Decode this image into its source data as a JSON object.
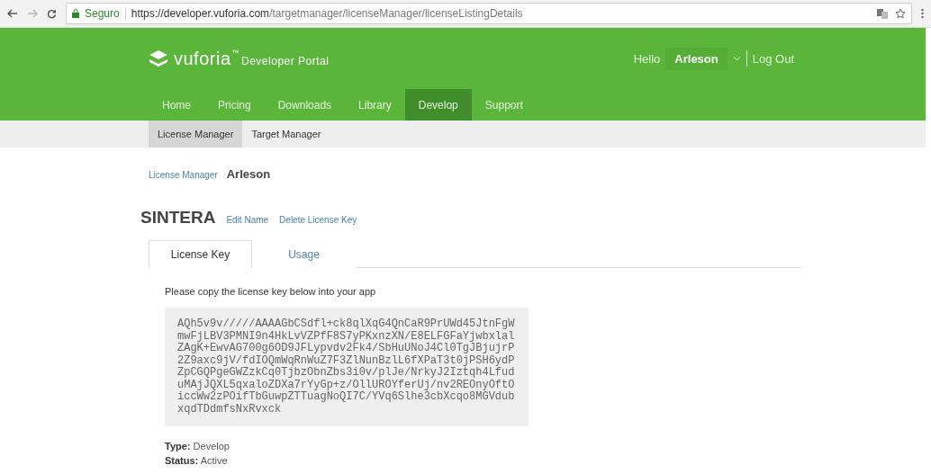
{
  "browser": {
    "security": "Seguro",
    "url_host": "https://developer.vuforia.com",
    "url_path": "/targetmanager/licenseManager/licenseListingDetails"
  },
  "header": {
    "brand": "vuforia",
    "trademark": "™",
    "brand_suffix": "Developer Portal",
    "greeting": "Hello",
    "user": "Arleson",
    "logout": "Log Out"
  },
  "nav": [
    {
      "label": "Home",
      "selected": false
    },
    {
      "label": "Pricing",
      "selected": false
    },
    {
      "label": "Downloads",
      "selected": false
    },
    {
      "label": "Library",
      "selected": false
    },
    {
      "label": "Develop",
      "selected": true
    },
    {
      "label": "Support",
      "selected": false
    }
  ],
  "subnav": [
    {
      "label": "License Manager",
      "selected": true
    },
    {
      "label": "Target Manager",
      "selected": false
    }
  ],
  "breadcrumb": {
    "link": "License Manager",
    "current": "Arleson"
  },
  "license": {
    "name": "SINTERA",
    "actions": [
      "Edit Name",
      "Delete License Key"
    ]
  },
  "tabs": [
    {
      "label": "License Key",
      "selected": true
    },
    {
      "label": "Usage",
      "selected": false
    }
  ],
  "instructions": "Please copy the license key below into your app",
  "key_lines": [
    "AQh5v9v/////AAAAGbCSdfl+ck8qlXqG4QnCaR9PrUWd45JtnFgW",
    "mwFjLBV3PMNI9n4HkLvVZPfF8S7yPKxnzXN/E8ELFGFaYjwbxlal",
    "ZAgK+EwvAG700g6OD9JFLypvdv2Fk4/SbHuUNoJ4Cl0TgJBjujrP",
    "2Z9axc9jV/fdIOQmWqRnWuZ7F3ZlNunBzlL6fXPaT3t0jPSH6ydP",
    "ZpCGQPgeGWZzkCq0TjbzObnZbs3i0v/plJe/NrkyJ2Iztqh4Lfud",
    "uMAjJQXL5qxaloZDXa7rYyGp+z/OllUROYferUj/nv2REOnyOftO",
    "iccWw2zPOifTbGuwpZTTuagNoQI7C/YVq6Slhe3cbXcqo8MGVdub",
    "xqdTDdmfsNxRvxck"
  ],
  "details": [
    "**Type:** Develop",
    "**Status:** Active"
  ]
}
